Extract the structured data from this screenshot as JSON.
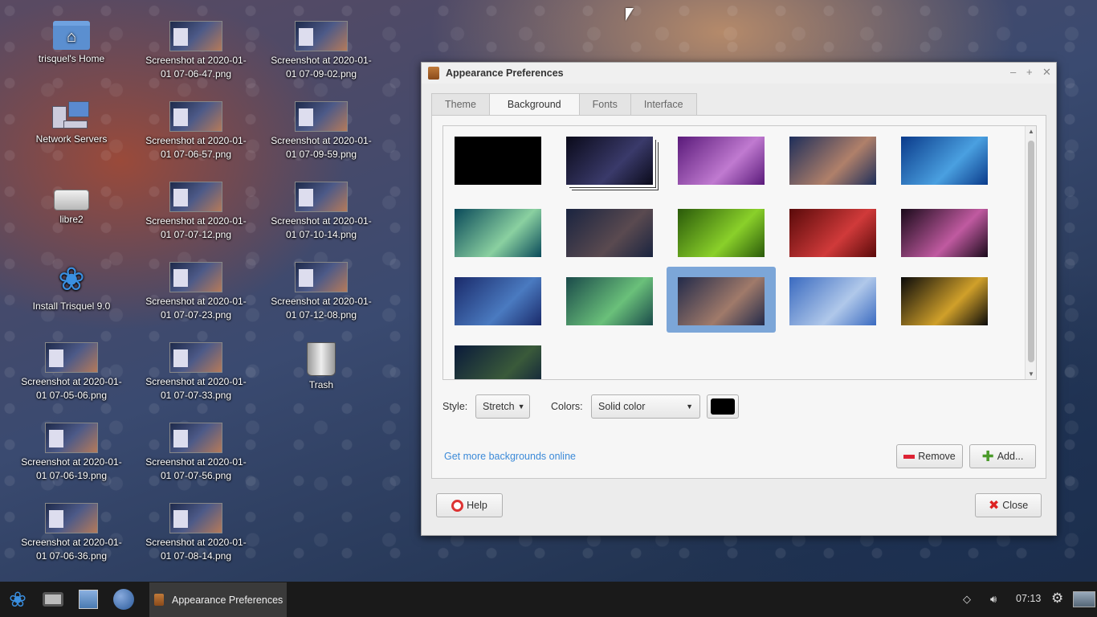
{
  "desktop": {
    "col1": [
      {
        "label": "trisquel's Home",
        "icon": "home-folder-icon"
      },
      {
        "label": "Network Servers",
        "icon": "network-servers-icon"
      },
      {
        "label": "libre2",
        "icon": "drive-icon"
      },
      {
        "label": "Install Trisquel 9.0",
        "icon": "trisquel-installer-icon"
      },
      {
        "l1": "Screenshot at 2020-01-",
        "l2": "01 07-05-06.png"
      },
      {
        "l1": "Screenshot at 2020-01-",
        "l2": "01 07-06-19.png"
      },
      {
        "l1": "Screenshot at 2020-01-",
        "l2": "01 07-06-36.png"
      }
    ],
    "col2": [
      {
        "l1": "Screenshot at 2020-01-",
        "l2": "01 07-06-47.png"
      },
      {
        "l1": "Screenshot at 2020-01-",
        "l2": "01 07-06-57.png"
      },
      {
        "l1": "Screenshot at 2020-01-",
        "l2": "01 07-07-12.png"
      },
      {
        "l1": "Screenshot at 2020-01-",
        "l2": "01 07-07-23.png"
      },
      {
        "l1": "Screenshot at 2020-01-",
        "l2": "01 07-07-33.png"
      },
      {
        "l1": "Screenshot at 2020-01-",
        "l2": "01 07-07-56.png"
      },
      {
        "l1": "Screenshot at 2020-01-",
        "l2": "01 07-08-14.png"
      }
    ],
    "col3": [
      {
        "l1": "Screenshot at 2020-01-",
        "l2": "01 07-09-02.png"
      },
      {
        "l1": "Screenshot at 2020-01-",
        "l2": "01 07-09-59.png"
      },
      {
        "l1": "Screenshot at 2020-01-",
        "l2": "01 07-10-14.png"
      },
      {
        "l1": "Screenshot at 2020-01-",
        "l2": "01 07-12-08.png"
      },
      {
        "label": "Trash",
        "icon": "trash-icon"
      }
    ]
  },
  "window": {
    "title": "Appearance Preferences",
    "tabs": [
      "Theme",
      "Background",
      "Fonts",
      "Interface"
    ],
    "active_tab": "Background",
    "wallpapers": [
      {
        "name": "black",
        "colors": [
          "#000000",
          "#000000"
        ]
      },
      {
        "name": "comet",
        "colors": [
          "#0a0a1a",
          "#3a3a6a"
        ]
      },
      {
        "name": "purple-waves",
        "colors": [
          "#5a1a7a",
          "#c07ad0"
        ]
      },
      {
        "name": "dusk-waves",
        "colors": [
          "#1e2e5a",
          "#b0806a"
        ]
      },
      {
        "name": "blue-waves",
        "colors": [
          "#0a3a8a",
          "#4aa0e0"
        ]
      },
      {
        "name": "teal-waves",
        "colors": [
          "#0a4a5a",
          "#8ad0a0"
        ]
      },
      {
        "name": "night-trees",
        "colors": [
          "#1a2440",
          "#5a4a50"
        ]
      },
      {
        "name": "green-stripes",
        "colors": [
          "#2a5a0a",
          "#8ad02a"
        ]
      },
      {
        "name": "red-curtain",
        "colors": [
          "#5a0a0a",
          "#d03a3a"
        ]
      },
      {
        "name": "pink-glow",
        "colors": [
          "#1a0a1a",
          "#c05aa0"
        ]
      },
      {
        "name": "blue-drops",
        "colors": [
          "#1a2a6a",
          "#4a7ac0"
        ]
      },
      {
        "name": "green-drops",
        "colors": [
          "#1a4a4a",
          "#6ac07a"
        ]
      },
      {
        "name": "dusk-drops",
        "colors": [
          "#222a4a",
          "#a07a6a"
        ]
      },
      {
        "name": "light-blue-waves",
        "colors": [
          "#3a6ac0",
          "#b0c8ea"
        ]
      },
      {
        "name": "rainbow-swirl",
        "colors": [
          "#0a0a0a",
          "#d0a02a"
        ]
      },
      {
        "name": "night-sky-tree",
        "colors": [
          "#0a1a3a",
          "#3a5a3a"
        ]
      }
    ],
    "selected_index": 12,
    "style_label": "Style:",
    "style_value": "Stretch",
    "colors_label": "Colors:",
    "colors_value": "Solid color",
    "color_swatch": "#000000",
    "link": "Get more backgrounds online",
    "remove_label": "Remove",
    "add_label": "Add...",
    "help_label": "Help",
    "close_label": "Close"
  },
  "taskbar": {
    "task_label": "Appearance Preferences",
    "clock": "07:13"
  }
}
